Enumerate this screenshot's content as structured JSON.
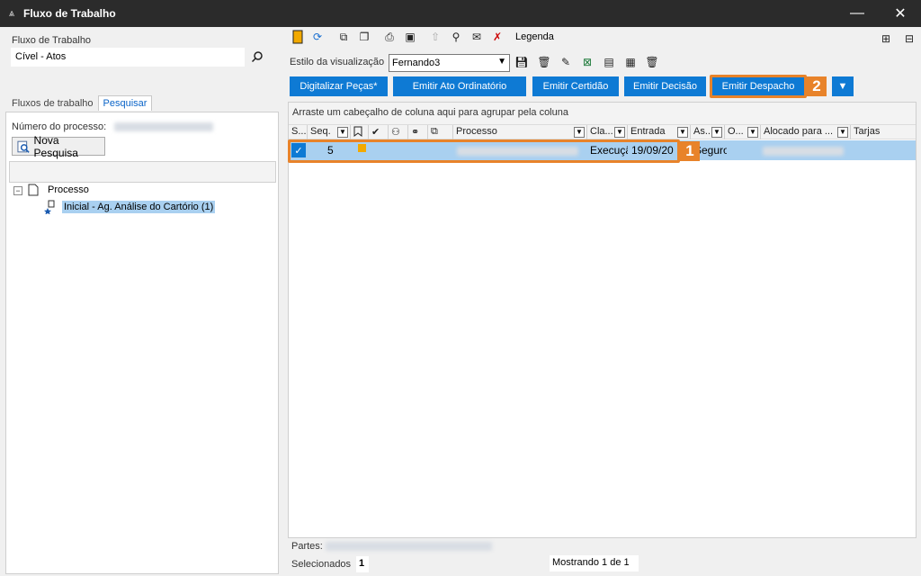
{
  "window": {
    "title": "Fluxo de Trabalho"
  },
  "left": {
    "workflow_label": "Fluxo de Trabalho",
    "workflow_value": "Cível - Atos",
    "tabs": [
      {
        "label": "Fluxos de trabalho"
      },
      {
        "label": "Pesquisar"
      }
    ],
    "process_number_label": "Número do processo:",
    "new_search_label": "Nova Pesquisa",
    "tree": {
      "root": "Processo",
      "child": "Inicial - Ag. Análise do Cartório (1)"
    }
  },
  "toolbar": {
    "legend_label": "Legenda",
    "view_style_label": "Estilo da visualização",
    "view_style_value": "Fernando3"
  },
  "actions": [
    {
      "label": "Digitalizar Peças*"
    },
    {
      "label": "Emitir Ato Ordinatório"
    },
    {
      "label": "Emitir Certidão"
    },
    {
      "label": "Emitir Decisão"
    },
    {
      "label": "Emitir Despacho"
    }
  ],
  "badges": {
    "row": "1",
    "button": "2"
  },
  "grid": {
    "group_hint": "Arraste um cabeçalho de coluna aqui para agrupar pela coluna",
    "columns": {
      "s": "S...",
      "seq": "Seq.",
      "processo": "Processo",
      "classe": "Cla...",
      "entrada": "Entrada",
      "assunto": "As...",
      "o": "O...",
      "alocado": "Alocado para ...",
      "tarjas": "Tarjas"
    },
    "row": {
      "seq": "5",
      "classe": "Execuçã",
      "entrada": "19/09/20",
      "assunto": "Seguro"
    }
  },
  "footer": {
    "partes_label": "Partes:",
    "selected_label": "Selecionados",
    "selected_count": "1",
    "showing": "Mostrando 1 de 1"
  },
  "colors": {
    "accent": "#0e7ad4",
    "highlight": "#e8832a",
    "selection": "#a9d0f0"
  }
}
